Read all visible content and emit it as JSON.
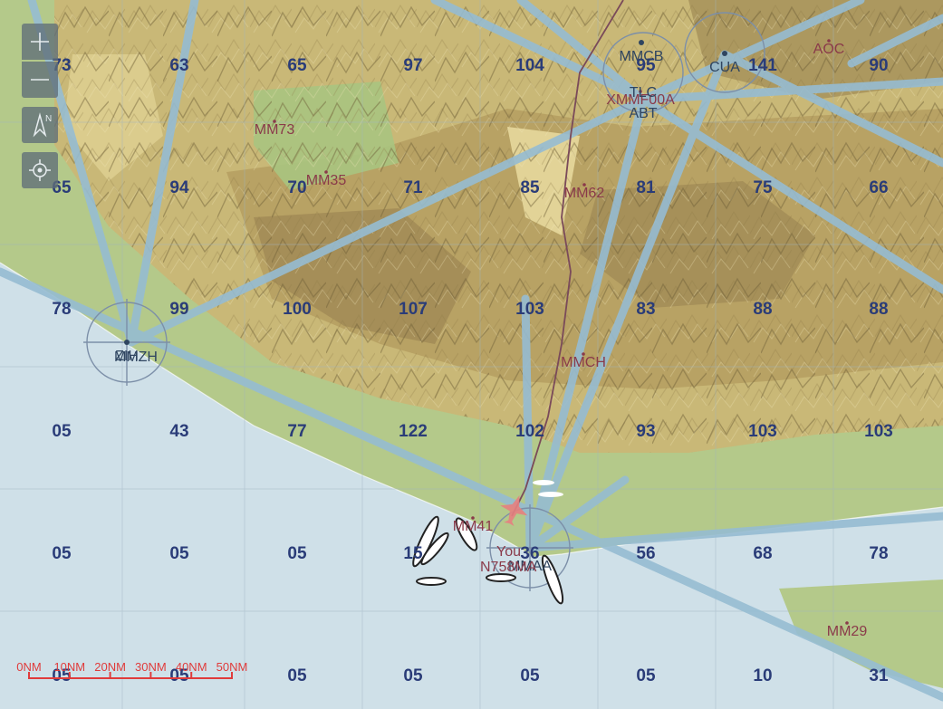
{
  "controls": {
    "zoom_in": "zoom-in",
    "zoom_out": "zoom-out",
    "north_indicator_letter": "N",
    "locate": "locate"
  },
  "colors": {
    "sea": "#cfe0e8",
    "lowland": "#b4c98a",
    "highland": "#c9b877",
    "mountain": "#a08a55",
    "airway": "#96bcd2",
    "grid_number": "#2a3c78",
    "waypoint_label": "#8a3a4a",
    "route_line": "#7a4a5a",
    "aircraft": "#e58080",
    "scale": "#e03b3b"
  },
  "grid_numbers": [
    [
      "73",
      "63",
      "65",
      "97",
      "104",
      "95",
      "141",
      "90"
    ],
    [
      "65",
      "94",
      "70",
      "71",
      "85",
      "81",
      "75",
      "66"
    ],
    [
      "78",
      "99",
      "100",
      "107",
      "103",
      "83",
      "88",
      "88"
    ],
    [
      "05",
      "43",
      "77",
      "122",
      "102",
      "93",
      "103",
      "103"
    ],
    [
      "05",
      "05",
      "05",
      "15",
      "36",
      "56",
      "68",
      "78"
    ],
    [
      "05",
      "05",
      "05",
      "05",
      "05",
      "05",
      "10",
      "31"
    ]
  ],
  "waypoints": [
    {
      "label": "MM73"
    },
    {
      "label": "MM35"
    },
    {
      "label": "MM62"
    },
    {
      "label": "MMCH"
    },
    {
      "label": "MM41"
    },
    {
      "label": "MM29"
    },
    {
      "label": "AOC"
    },
    {
      "label": "XMMF00A"
    }
  ],
  "airports": [
    {
      "label": "MMCB"
    },
    {
      "label": "TLC"
    },
    {
      "label": "ABT"
    },
    {
      "label": "CUA"
    },
    {
      "label": "ZIH"
    },
    {
      "label": "MMZH"
    },
    {
      "label": "MMAA"
    }
  ],
  "ownship": {
    "label": "You",
    "callsign": "N758MA"
  },
  "scale_bar": {
    "labels": [
      "0NM",
      "10NM",
      "20NM",
      "30NM",
      "40NM",
      "50NM"
    ]
  }
}
